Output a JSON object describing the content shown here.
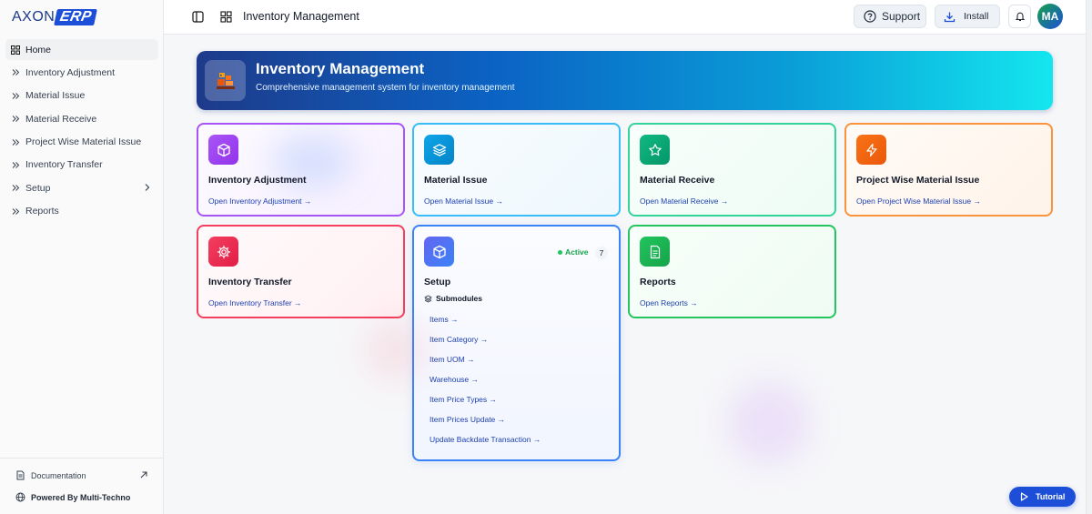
{
  "logo": {
    "part1": "AXON",
    "part2": "ERP"
  },
  "sidebar": {
    "items": [
      {
        "label": "Home"
      },
      {
        "label": "Inventory Adjustment"
      },
      {
        "label": "Material Issue"
      },
      {
        "label": "Material Receive"
      },
      {
        "label": "Project Wise Material Issue"
      },
      {
        "label": "Inventory Transfer"
      },
      {
        "label": "Setup"
      },
      {
        "label": "Reports"
      }
    ],
    "footer": {
      "documentation": "Documentation",
      "powered": "Powered By Multi-Techno"
    }
  },
  "header": {
    "title": "Inventory Management",
    "support": "Support",
    "install": "Install",
    "avatar": "MA"
  },
  "banner": {
    "title": "Inventory Management",
    "subtitle": "Comprehensive management system for inventory management"
  },
  "cards": [
    {
      "title": "Inventory Adjustment",
      "link": "Open Inventory Adjustment",
      "color": "#9333ea"
    },
    {
      "title": "Material Issue",
      "link": "Open Material Issue",
      "color": "#0ea5e9"
    },
    {
      "title": "Material Receive",
      "link": "Open Material Receive",
      "color": "#10b981"
    },
    {
      "title": "Project Wise Material Issue",
      "link": "Open Project Wise Material Issue",
      "color": "#f97316"
    },
    {
      "title": "Inventory Transfer",
      "link": "Open Inventory Transfer",
      "color": "#e11d48"
    },
    {
      "title": "Setup",
      "badge": "Active",
      "count": "7",
      "submodules_label": "Submodules",
      "submodules": [
        "Items",
        "Item Category",
        "Item UOM",
        "Warehouse",
        "Item Price Types",
        "Item Prices Update",
        "Update Backdate Transaction"
      ],
      "color": "#3b82f6"
    },
    {
      "title": "Reports",
      "link": "Open Reports",
      "color": "#16a34a"
    }
  ],
  "tutorial": "Tutorial"
}
